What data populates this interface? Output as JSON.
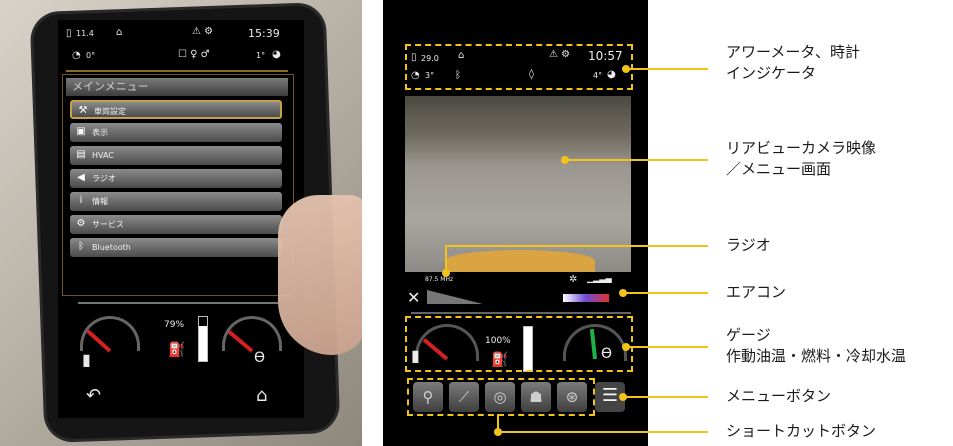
{
  "colors": {
    "accent": "#f2c31a",
    "screen_bg": "#000000",
    "menu_highlight": "#c9a04a"
  },
  "left_screen": {
    "status_top": {
      "left_value": "11.4",
      "time": "15:39"
    },
    "status_second": {
      "left_angle": "0°",
      "right_angle": "1°"
    },
    "menu": {
      "title": "メインメニュー",
      "items": [
        {
          "label": "車両設定",
          "icon": "vehicle-settings-icon"
        },
        {
          "label": "表示",
          "icon": "display-icon"
        },
        {
          "label": "HVAC",
          "icon": "hvac-icon"
        },
        {
          "label": "ラジオ",
          "icon": "speaker-icon"
        },
        {
          "label": "情報",
          "icon": "info-icon"
        },
        {
          "label": "サービス",
          "icon": "wrench-icon"
        },
        {
          "label": "Bluetooth",
          "icon": "bluetooth-icon"
        }
      ]
    },
    "gauges": {
      "fuel_percent": "79%"
    }
  },
  "right_screen": {
    "status_top": {
      "left_value": "29.0",
      "time": "10:57"
    },
    "status_second": {
      "left_angle": "3°",
      "right_angle": "4°"
    },
    "radio": {
      "frequency": "87.5 MHz"
    },
    "gauges": {
      "fuel_percent": "100%"
    }
  },
  "callouts": [
    {
      "id": "hourmeter",
      "lines": [
        "アワーメータ、時計",
        "インジケータ"
      ]
    },
    {
      "id": "camera",
      "lines": [
        "リアビューカメラ映像",
        "／メニュー画面"
      ]
    },
    {
      "id": "radio",
      "lines": [
        "ラジオ"
      ]
    },
    {
      "id": "aircon",
      "lines": [
        "エアコン"
      ]
    },
    {
      "id": "gauge",
      "lines": [
        "ゲージ",
        "作動油温・燃料・冷却水温"
      ]
    },
    {
      "id": "menu-button",
      "lines": [
        "メニューボタン"
      ]
    },
    {
      "id": "shortcut",
      "lines": [
        "ショートカットボタン"
      ]
    }
  ]
}
